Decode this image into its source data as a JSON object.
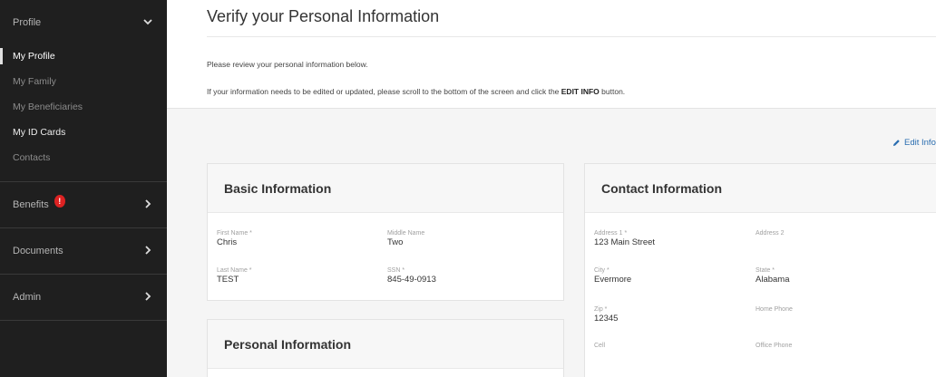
{
  "sidebar": {
    "profile": {
      "label": "Profile",
      "items": [
        {
          "label": "My Profile"
        },
        {
          "label": "My Family"
        },
        {
          "label": "My Beneficiaries"
        },
        {
          "label": "My ID Cards"
        },
        {
          "label": "Contacts"
        }
      ]
    },
    "benefits": {
      "label": "Benefits",
      "badge": "!"
    },
    "documents": {
      "label": "Documents"
    },
    "admin": {
      "label": "Admin"
    }
  },
  "header": {
    "title": "Verify your Personal Information",
    "intro_line1": "Please review your personal information below.",
    "intro_line2_prefix": "If your information needs to be edited or updated, please scroll to the bottom of the screen and click the ",
    "intro_line2_bold": "EDIT INFO",
    "intro_line2_suffix": " button."
  },
  "edit_link": {
    "label": "Edit Info"
  },
  "basic_info": {
    "title": "Basic Information",
    "fields": {
      "first_name": {
        "label": "First Name *",
        "value": "Chris"
      },
      "middle_name": {
        "label": "Middle Name",
        "value": "Two"
      },
      "last_name": {
        "label": "Last Name *",
        "value": "TEST"
      },
      "ssn": {
        "label": "SSN *",
        "value": "845-49-0913"
      }
    }
  },
  "contact_info": {
    "title": "Contact Information",
    "fields": {
      "address1": {
        "label": "Address 1 *",
        "value": "123 Main Street"
      },
      "address2": {
        "label": "Address 2",
        "value": ""
      },
      "city": {
        "label": "City *",
        "value": "Evermore"
      },
      "state": {
        "label": "State *",
        "value": "Alabama"
      },
      "zip": {
        "label": "Zip *",
        "value": "12345"
      },
      "home_phone": {
        "label": "Home Phone",
        "value": ""
      },
      "cell": {
        "label": "Cell",
        "value": ""
      },
      "office_phone": {
        "label": "Office Phone",
        "value": ""
      }
    }
  },
  "personal_info": {
    "title": "Personal Information"
  },
  "colors": {
    "sidebar_bg": "#1f1f1f",
    "link": "#2a6db0",
    "badge": "#dd2222"
  }
}
